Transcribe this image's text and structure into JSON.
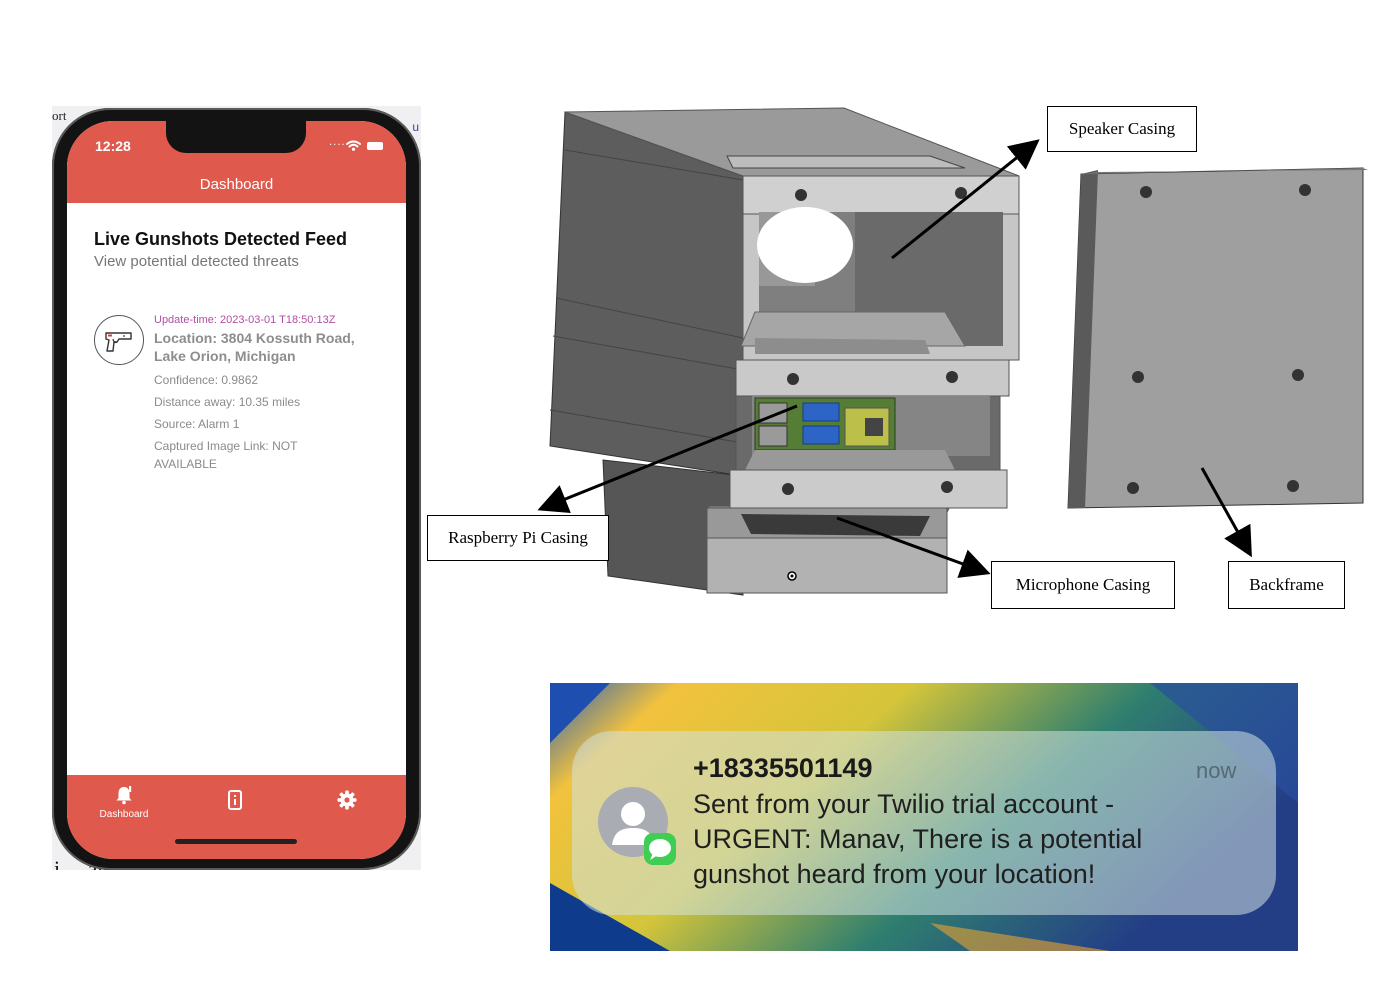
{
  "phone": {
    "background_fragments": {
      "top_left": "ort",
      "top_right": "u",
      "bottom": "i ... and Interpretation"
    },
    "status_bar": {
      "time": "12:28",
      "signal": "....",
      "icons": [
        "wifi-icon",
        "battery-icon"
      ]
    },
    "header": {
      "title": "Dashboard",
      "color": "#e0594d"
    },
    "feed": {
      "title": "Live Gunshots Detected Feed",
      "subtitle": "View potential detected threats",
      "alerts": [
        {
          "icon": "gun-icon",
          "update_time": "Update-time: 2023-03-01 T18:50:13Z",
          "location": "Location: 3804 Kossuth Road, Lake Orion, Michigan",
          "confidence": "Confidence: 0.9862",
          "distance": "Distance away: 10.35 miles",
          "source": "Source: Alarm 1",
          "image_link": "Captured Image Link: NOT AVAILABLE"
        }
      ]
    },
    "tab_bar": {
      "tabs": [
        {
          "icon": "bell-icon",
          "label": "Dashboard",
          "active": true
        },
        {
          "icon": "device-icon",
          "label": ""
        },
        {
          "icon": "gear-icon",
          "label": ""
        }
      ]
    }
  },
  "cad_diagram": {
    "labels": {
      "speaker": "Speaker Casing",
      "raspberry_pi": "Raspberry Pi Casing",
      "microphone": "Microphone Casing",
      "backframe": "Backframe"
    }
  },
  "notification": {
    "sender": "+18335501149",
    "time": "now",
    "body": "Sent from your Twilio trial account - URGENT: Manav, There is a potential gunshot heard from your location!",
    "app_icon": "messages-icon",
    "avatar": "contact-avatar-icon"
  }
}
